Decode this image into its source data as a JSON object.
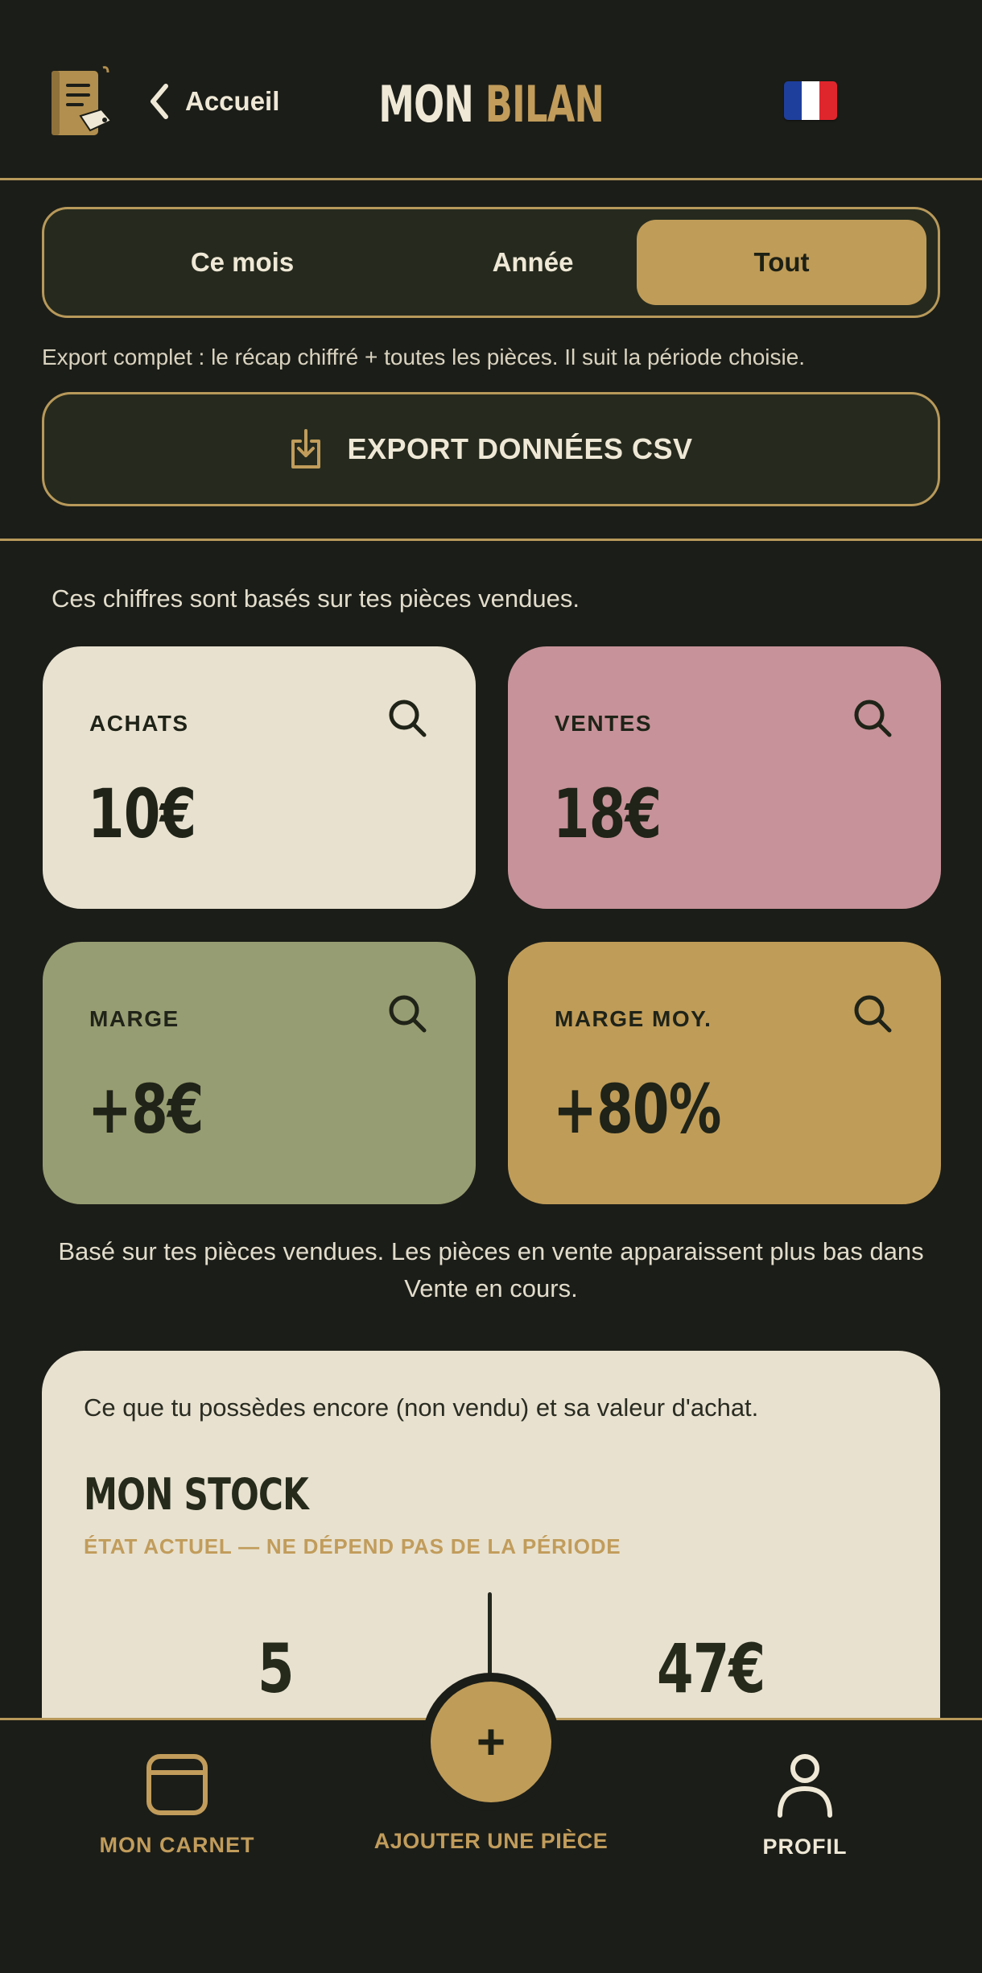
{
  "header": {
    "back_label": "Accueil",
    "title_part1": "MON",
    "title_part2": "BILAN",
    "flag_colors": [
      "#1e3f9c",
      "#ffffff",
      "#e0262d"
    ]
  },
  "period": {
    "options": [
      "Ce mois",
      "Année",
      "Tout"
    ],
    "selected": "Tout"
  },
  "export": {
    "hint": "Export complet : le récap chiffré + toutes les pièces. Il suit la période choisie.",
    "button_label": "EXPORT DONNÉES CSV",
    "icon": "download-icon"
  },
  "stats": {
    "basis_note": "Ces chiffres sont basés sur tes pièces vendues.",
    "cards": [
      {
        "label": "ACHATS",
        "value": "10€",
        "color": "#e8e1cf",
        "icon": "search-icon"
      },
      {
        "label": "VENTES",
        "value": "18€",
        "color": "#c79299",
        "icon": "search-icon"
      },
      {
        "label": "MARGE",
        "value": "+8€",
        "color": "#979d72",
        "icon": "search-icon"
      },
      {
        "label": "MARGE MOY.",
        "value": "+80%",
        "color": "#bf9c58",
        "icon": "search-icon"
      }
    ],
    "footer_note": "Basé sur tes pièces vendues. Les pièces en vente apparaissent plus bas dans Vente en cours."
  },
  "stock": {
    "description": "Ce que tu possèdes encore (non vendu) et sa valeur d'achat.",
    "title": "MON STOCK",
    "subtitle": "ÉTAT ACTUEL — NE DÉPEND PAS DE LA PÉRIODE",
    "count": "5",
    "value": "47€"
  },
  "nav": {
    "left_label": "MON CARNET",
    "center_label": "AJOUTER UNE PIÈCE",
    "center_symbol": "+",
    "right_label": "PROFIL"
  },
  "colors": {
    "background": "#1b1d18",
    "accent": "#bf9c58",
    "border": "#b8995a"
  }
}
